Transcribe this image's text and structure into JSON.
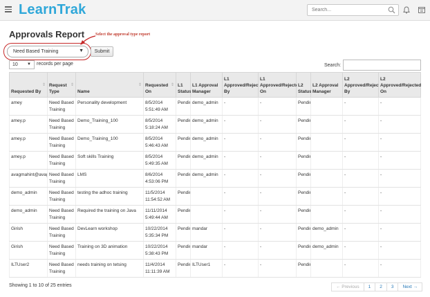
{
  "app": {
    "logo": "LearnTrak"
  },
  "header": {
    "search_placeholder": "Search..."
  },
  "page": {
    "title": "Approvals Report",
    "callout": "Select the approval type report",
    "approval_type_selected": "Need Based Training",
    "submit_label": "Submit"
  },
  "table_controls": {
    "page_length": "10",
    "records_label": "records per page",
    "search_label": "Search:"
  },
  "table": {
    "columns": [
      "Requested By",
      "Request Type",
      "Name",
      "Requested On",
      "L1 Status",
      "L1 Approval Manager",
      "L1 Approved/Rejected By",
      "L1 Approved/Rejected On",
      "L2 Status",
      "L2 Approval Manager",
      "L2 Approved/Rejected By",
      "L2 Approved/Rejected On"
    ],
    "rows": [
      [
        "amey",
        "Need Based Training",
        "Personality development",
        "8/5/2014 5:51:49 AM",
        "Pending",
        "demo_admin",
        "-",
        "-",
        "Pending",
        "",
        "-",
        "-"
      ],
      [
        "amey.p",
        "Need Based Training",
        "Demo_Training_100",
        "8/5/2014 5:18:24 AM",
        "Pending",
        "demo_admin",
        "-",
        "-",
        "Pending",
        "",
        "-",
        "-"
      ],
      [
        "amey.p",
        "Need Based Training",
        "Demo_Training_100",
        "8/5/2014 5:46:43 AM",
        "Pending",
        "demo_admin",
        "-",
        "-",
        "Pending",
        "",
        "-",
        "-"
      ],
      [
        "amey.p",
        "Need Based Training",
        "Soft skills Training",
        "8/5/2014 5:49:35 AM",
        "Pending",
        "demo_admin",
        "-",
        "-",
        "Pending",
        "",
        "-",
        "-"
      ],
      [
        "avagmahint@avagmah.com",
        "Need Based Training",
        "LMS",
        "8/6/2014 4:53:06 PM",
        "Pending",
        "demo_admin",
        "-",
        "-",
        "Pending",
        "",
        "-",
        "-"
      ],
      [
        "demo_admin",
        "Need Based Training",
        "testing the adhoc training",
        "11/5/2014 11:54:52 AM",
        "Pending",
        "",
        "-",
        "-",
        "Pending",
        "",
        "-",
        "-"
      ],
      [
        "demo_admin",
        "Need Based Training",
        "Required the training on Java",
        "11/11/2014 5:49:44 AM",
        "Pending",
        "",
        "-",
        "-",
        "Pending",
        "",
        "-",
        "-"
      ],
      [
        "Girish",
        "Need Based Training",
        "DevLearn workshop",
        "10/22/2014 5:35:34 PM",
        "Pending",
        "mandar",
        "-",
        "-",
        "Pending",
        "demo_admin",
        "-",
        "-"
      ],
      [
        "Girish",
        "Need Based Training",
        "Training on 3D animation",
        "10/22/2014 5:38:43 PM",
        "Pending",
        "mandar",
        "-",
        "-",
        "Pending",
        "demo_admin",
        "-",
        "-"
      ],
      [
        "ILTUser2",
        "Need Based Training",
        "needs training on tetsing",
        "11/4/2014 11:11:39 AM",
        "Pending",
        "ILTUser1",
        "-",
        "-",
        "Pending",
        "",
        "-",
        "-"
      ]
    ]
  },
  "footer": {
    "info": "Showing 1 to 10 of 25 entries",
    "pagination": [
      "← Previous",
      "1",
      "2",
      "3",
      "Next →"
    ]
  },
  "colors": {
    "brand": "#2ea7d9",
    "callout": "#c0392b",
    "ring": "#c62828"
  },
  "icons": [
    "menu-icon",
    "search-icon",
    "bell-icon",
    "calendar-icon",
    "chevron-down-icon",
    "sort-icon"
  ]
}
